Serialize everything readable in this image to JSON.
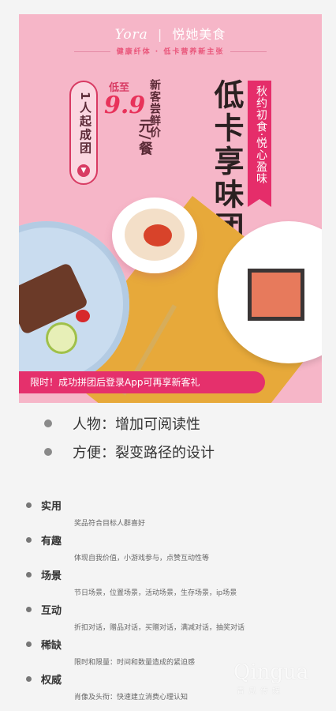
{
  "poster": {
    "brand_logo": "Yora",
    "brand_sep": "|",
    "brand_name": "悦她美食",
    "tagline": "健康纤体 · 低卡营养新主张",
    "group_pill": "1人起成团",
    "price_prefix": "低至",
    "price_value": "9.9",
    "price_unit": "元/餐",
    "new_customer": "新客尝鲜价",
    "headline": "低卡享味团",
    "ribbon": "秋约初食·悦心盈味",
    "banner": "限时！成功拼团后登录App可再享新客礼"
  },
  "big_bullets": [
    {
      "text": "人物：增加可阅读性"
    },
    {
      "text": "方便：裂变路径的设计"
    }
  ],
  "features": [
    {
      "title": "实用",
      "desc": "奖品符合目标人群喜好"
    },
    {
      "title": "有趣",
      "desc": "体现自我价值，小游戏参与，点赞互动性等"
    },
    {
      "title": "场景",
      "desc": "节日场景，位置场景，活动场景，生存场景，ip场景"
    },
    {
      "title": "互动",
      "desc": "折扣对话，赠品对话，买赠对话，满减对话，抽奖对话"
    },
    {
      "title": "稀缺",
      "desc": "限时和限量：时间和数量造成的紧迫感"
    },
    {
      "title": "权威",
      "desc": "肖像及头衔：快速建立消费心理认知"
    }
  ],
  "watermark": {
    "logo": "Qingua",
    "sub": "青瓜传媒"
  },
  "icons": {
    "chevron": "chevron-down-icon"
  },
  "colors": {
    "poster_bg": "#f6b6c8",
    "accent": "#e5306c"
  }
}
